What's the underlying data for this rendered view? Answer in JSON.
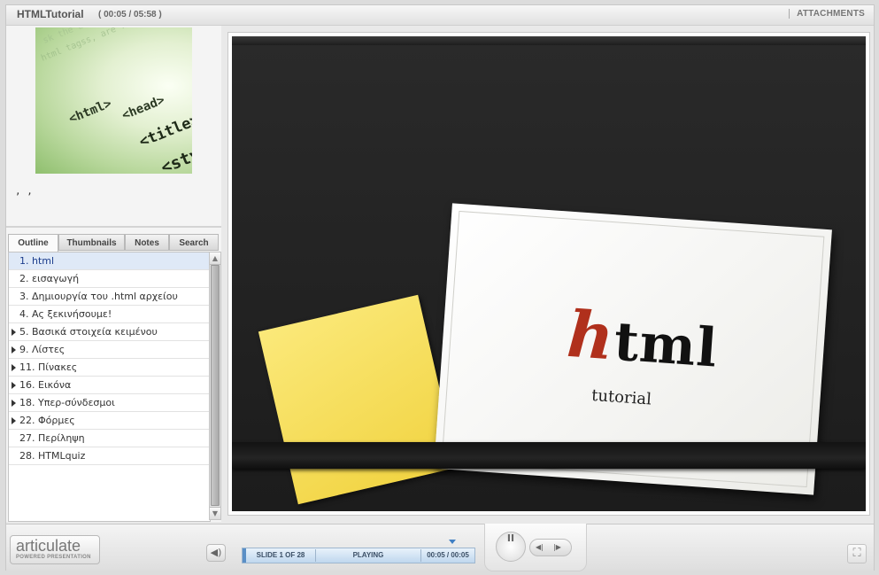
{
  "window": {
    "title": "HTMLTutorial",
    "time": "( 00:05 / 05:58 )",
    "attachments_label": "ATTACHMENTS"
  },
  "sidebar": {
    "description": ", ,",
    "thumbnail_code": [
      "<html>",
      "<head>",
      "<title>",
      "<sty"
    ],
    "tabs": [
      {
        "label": "Outline",
        "active": true
      },
      {
        "label": "Thumbnails",
        "active": false
      },
      {
        "label": "Notes",
        "active": false
      },
      {
        "label": "Search",
        "active": false
      }
    ],
    "outline": [
      {
        "label": "1. html",
        "expandable": false,
        "selected": true
      },
      {
        "label": "2. εισαγωγή",
        "expandable": false,
        "selected": false
      },
      {
        "label": "3. Δημιουργία του  .html αρχείου",
        "expandable": false,
        "selected": false
      },
      {
        "label": "4. Ας ξεκινήσουμε!",
        "expandable": false,
        "selected": false
      },
      {
        "label": "5. Βασικά στοιχεία κειμένου",
        "expandable": true,
        "selected": false
      },
      {
        "label": "9. Λίστες",
        "expandable": true,
        "selected": false
      },
      {
        "label": "11. Πίνακες",
        "expandable": true,
        "selected": false
      },
      {
        "label": "16. Εικόνα",
        "expandable": true,
        "selected": false
      },
      {
        "label": "18. Υπερ-σύνδεσμοι",
        "expandable": true,
        "selected": false
      },
      {
        "label": "22. Φόρμες",
        "expandable": true,
        "selected": false
      },
      {
        "label": "27. Περίληψη",
        "expandable": false,
        "selected": false
      },
      {
        "label": "28. HTMLquiz",
        "expandable": false,
        "selected": false
      }
    ]
  },
  "slide": {
    "logo_h": "h",
    "logo_rest": "tml",
    "subtitle": "tutorial"
  },
  "player": {
    "brand_name": "articulate",
    "brand_tagline": "POWERED PRESENTATION",
    "slide_counter": "SLIDE 1 OF 28",
    "status": "PLAYING",
    "elapsed": "00:05 / 00:05",
    "pause_glyph": "II",
    "prev_glyph": "◀|",
    "next_glyph": "|▶"
  }
}
